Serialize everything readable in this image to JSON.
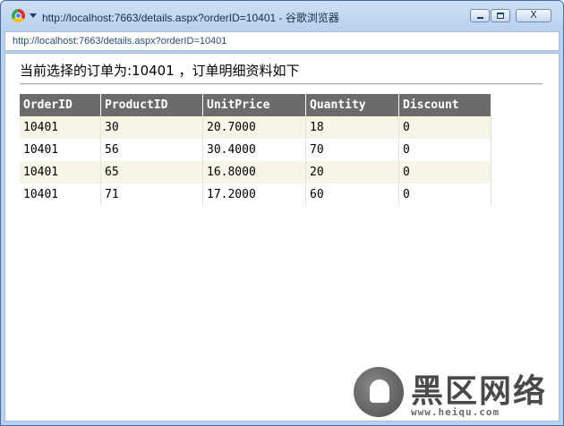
{
  "window": {
    "title": "http://localhost:7663/details.aspx?orderID=10401 - 谷歌浏览器",
    "close_glyph": "X"
  },
  "addressbar": {
    "url": "http://localhost:7663/details.aspx?orderID=10401"
  },
  "page": {
    "heading": "当前选择的订单为:10401 ，订单明细资料如下"
  },
  "table": {
    "columns": [
      "OrderID",
      "ProductID",
      "UnitPrice",
      "Quantity",
      "Discount"
    ],
    "rows": [
      [
        "10401",
        "30",
        "20.7000",
        "18",
        "0"
      ],
      [
        "10401",
        "56",
        "30.4000",
        "70",
        "0"
      ],
      [
        "10401",
        "65",
        "16.8000",
        "20",
        "0"
      ],
      [
        "10401",
        "71",
        "17.2000",
        "60",
        "0"
      ]
    ],
    "colors": {
      "header_bg": "#6b6b6b",
      "header_text": "#ffffff",
      "alt_row_bg": "#f6f5e6"
    }
  },
  "watermark": {
    "name": "黑区网络",
    "url": "www.heiqu.com"
  },
  "icons": {
    "browser": "chrome-icon",
    "menu": "dropdown-arrow-icon"
  }
}
